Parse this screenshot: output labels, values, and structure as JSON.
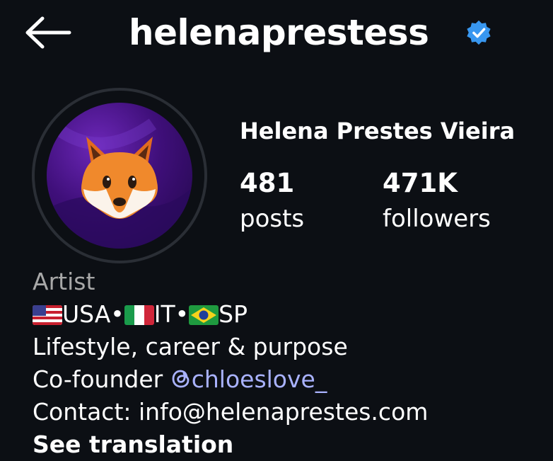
{
  "header": {
    "username": "helenaprestess",
    "icons": {
      "back": "back-arrow-icon",
      "verified": "verified-badge-icon"
    },
    "verified_color": "#3897f0"
  },
  "profile": {
    "full_name": "Helena Prestes Vieira",
    "avatar_icon": "fox-emoji-avatar",
    "stats": {
      "posts": {
        "value": "481",
        "label": "posts"
      },
      "followers": {
        "value": "471K",
        "label": "followers"
      }
    }
  },
  "bio": {
    "category": "Artist",
    "locations": [
      {
        "flag_icon": "flag-usa-icon",
        "text": "USA"
      },
      {
        "separator": "•"
      },
      {
        "flag_icon": "flag-italy-icon",
        "text": "IT"
      },
      {
        "separator": "•"
      },
      {
        "flag_icon": "flag-brazil-icon",
        "text": "SP"
      }
    ],
    "loc_text": {
      "usa": "USA",
      "sep": "•",
      "it": "IT",
      "sp": "SP"
    },
    "tagline": "Lifestyle, career & purpose",
    "cofounder_prefix": "Co-founder",
    "cofounder_handle": "chloeslove_",
    "contact": "Contact: info@helenaprestes.com",
    "see_translation": "See translation"
  },
  "colors": {
    "background": "#0c0f14",
    "text": "#ffffff",
    "muted": "#a8a8a8",
    "link": "#a9b2ff"
  }
}
